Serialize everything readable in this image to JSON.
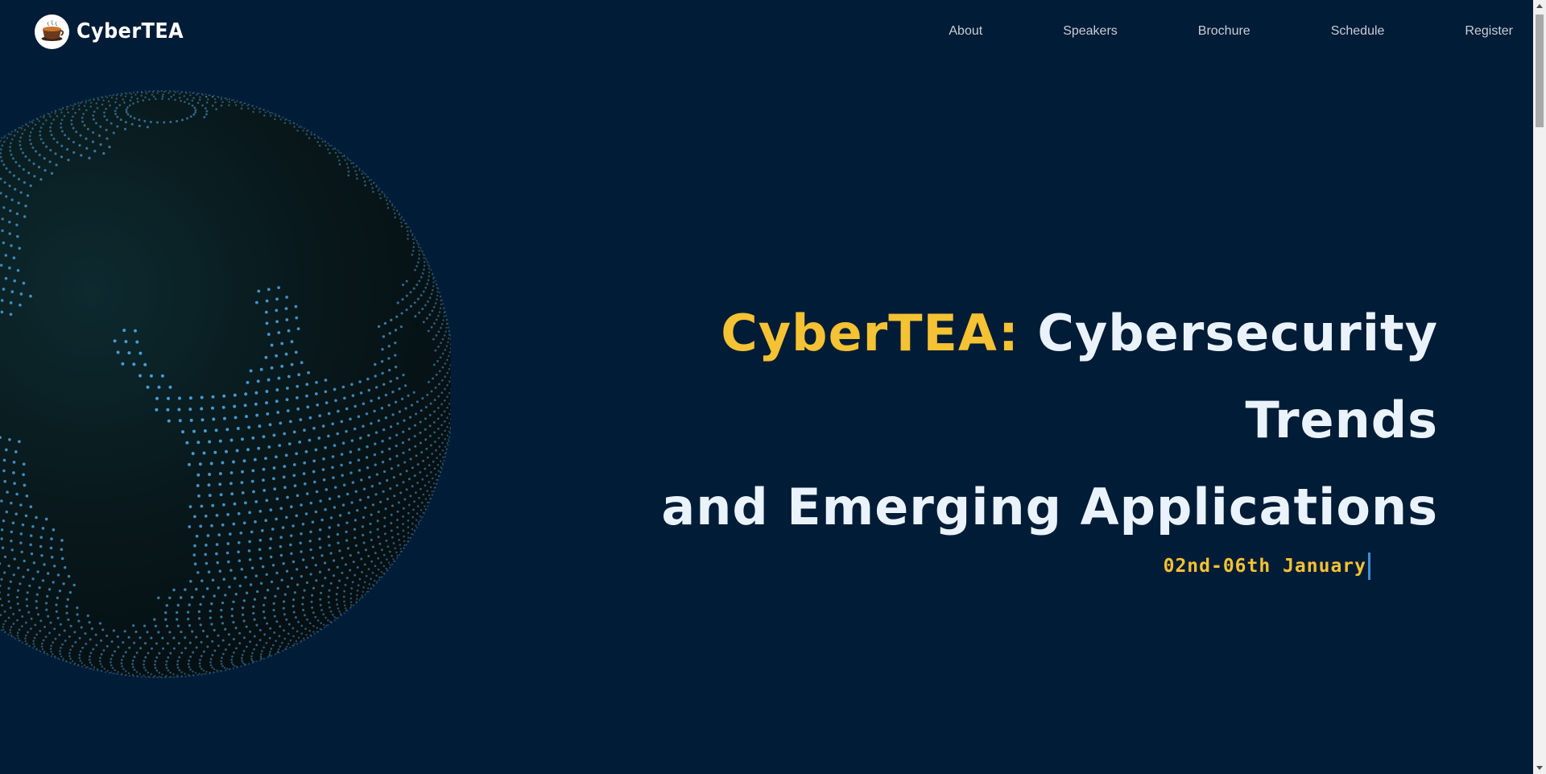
{
  "header": {
    "brand_name": "CyberTEA",
    "logo_icon": "teacup-icon",
    "nav": [
      {
        "label": "About"
      },
      {
        "label": "Speakers"
      },
      {
        "label": "Brochure"
      },
      {
        "label": "Schedule"
      },
      {
        "label": "Register"
      }
    ]
  },
  "hero": {
    "title_accent": "CyberTEA:",
    "title_line1": " Cybersecurity Trends",
    "title_line2": "and Emerging Applications",
    "date": "02nd-06th January"
  },
  "visual": {
    "globe_icon": "dotted-globe-icon"
  },
  "colors": {
    "background": "#001c36",
    "accent": "#f5c234",
    "title": "#eaf3fb",
    "nav_text": "#c9ced6",
    "globe_dots": "#4aa3e0",
    "caret": "#3d8fd6"
  }
}
